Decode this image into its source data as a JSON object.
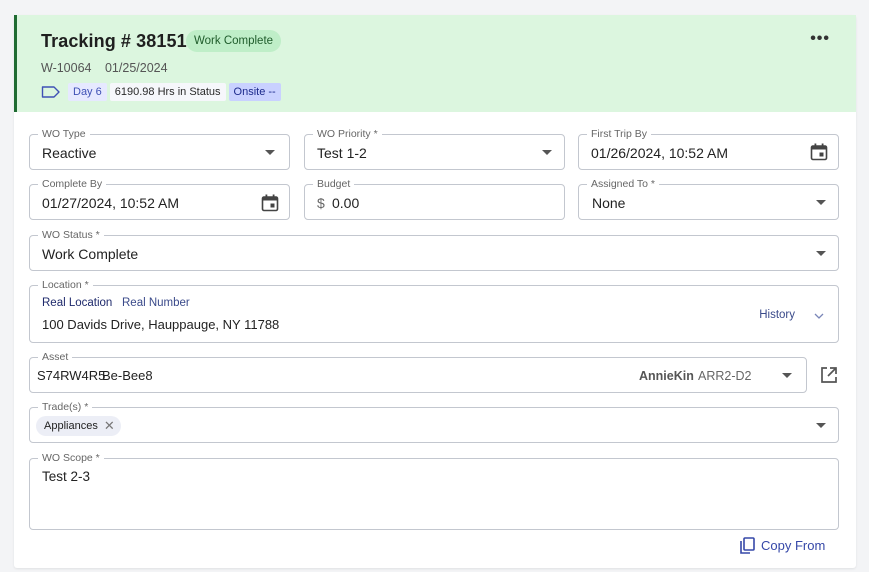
{
  "header": {
    "title": "Tracking # 38151",
    "status": "Work Complete",
    "wo_number": "W-10064",
    "date": "01/25/2024",
    "day": "Day 6",
    "hours": "6190.98 Hrs in Status",
    "onsite": "Onsite --",
    "more_icon": "more-horizontal-icon"
  },
  "fields": {
    "wo_type": {
      "label": "WO Type",
      "value": "Reactive"
    },
    "wo_priority": {
      "label": "WO Priority *",
      "value": "Test 1-2"
    },
    "first_trip_by": {
      "label": "First Trip By",
      "value": "01/26/2024, 10:52 AM"
    },
    "complete_by": {
      "label": "Complete By",
      "value": "01/27/2024, 10:52 AM"
    },
    "budget": {
      "label": "Budget",
      "currency": "$",
      "value": "0.00"
    },
    "assigned_to": {
      "label": "Assigned To *",
      "value": "None"
    },
    "wo_status": {
      "label": "WO Status *",
      "value": "Work Complete"
    },
    "location": {
      "label": "Location *",
      "name_label": "Real Location",
      "number_label": "Real Number",
      "address": "100 Davids Drive, Hauppauge, NY 11788",
      "history_label": "History"
    },
    "asset": {
      "label": "Asset",
      "code": "S74RW4R5",
      "name": "Be-Bee8",
      "owner": "AnnieKin",
      "model": "ARR2-D2"
    },
    "trades": {
      "label": "Trade(s) *",
      "chips": [
        "Appliances"
      ]
    },
    "wo_scope": {
      "label": "WO Scope *",
      "value": "Test 2-3"
    }
  },
  "actions": {
    "copy_from": "Copy From"
  },
  "colors": {
    "header_bg": "#dcf6df",
    "header_accent": "#1f6b32",
    "badge_bg": "#bfeec8",
    "link": "#3648a8"
  }
}
